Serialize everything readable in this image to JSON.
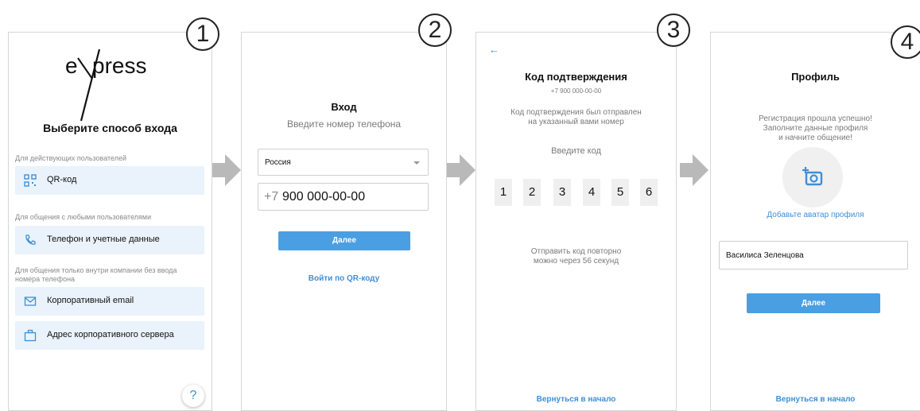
{
  "badges": [
    "1",
    "2",
    "3",
    "4"
  ],
  "screen1": {
    "logo_prefix": "e",
    "logo_suffix": "press",
    "title": "Выберите способ входа",
    "section_existing": "Для действующих пользователей",
    "qr_label": "QR-код",
    "section_any": "Для общения с любыми пользователями",
    "phone_label": "Телефон и учетные данные",
    "section_internal": "Для общения только внутри компании без ввода номера телефона",
    "email_label": "Корпоративный email",
    "server_label": "Адрес корпоративного сервера",
    "help": "?"
  },
  "screen2": {
    "title": "Вход",
    "subtitle": "Введите номер телефона",
    "country": "Россия",
    "phone_prefix": "+7",
    "phone_number": "900 000-00-00",
    "next_button": "Далее",
    "qr_link": "Войти по QR-коду"
  },
  "screen3": {
    "back": "←",
    "title": "Код подтверждения",
    "phone": "+7 900 000-00-00",
    "sent_line1": "Код подтверждения был отправлен",
    "sent_line2": "на указанный вами номер",
    "enter_code": "Введите код",
    "digits": [
      "1",
      "2",
      "3",
      "4",
      "5",
      "6"
    ],
    "resend_line1": "Отправить код повторно",
    "resend_line2": "можно через 56 секунд",
    "back_link": "Вернуться в начало"
  },
  "screen4": {
    "title": "Профиль",
    "success_line1": "Регистрация прошла успешно!",
    "success_line2": "Заполните данные профиля",
    "success_line3": "и начните общение!",
    "add_avatar": "Добавьте аватар профиля",
    "name_value": "Василиса Зеленцова",
    "next_button": "Далее",
    "back_link": "Вернуться в начало"
  },
  "colors": {
    "accent": "#4a9fe3",
    "link": "#3f8fd6",
    "option_bg": "#eaf3fb",
    "arrow": "#b9b9b9"
  }
}
